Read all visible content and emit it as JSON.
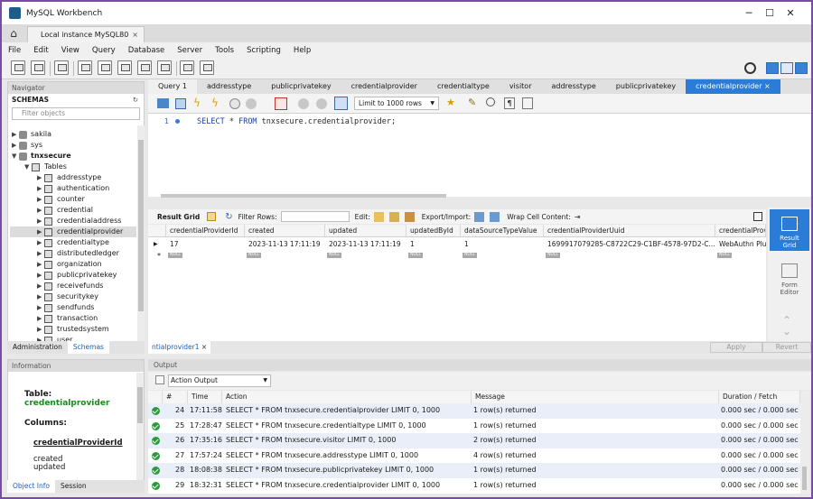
{
  "window": {
    "title": "MySQL Workbench",
    "minimize": "─",
    "maximize": "☐",
    "close": "✕"
  },
  "conn_tab": {
    "label": "Local instance MySQL80",
    "close": "×"
  },
  "menu": [
    "File",
    "Edit",
    "View",
    "Query",
    "Database",
    "Server",
    "Tools",
    "Scripting",
    "Help"
  ],
  "navigator": {
    "header": "Navigator",
    "schemas_label": "SCHEMAS",
    "filter_placeholder": "Filter objects",
    "schemas": [
      "sakila",
      "sys",
      "tnxsecure"
    ],
    "tables_label": "Tables",
    "tables": [
      "addresstype",
      "authentication",
      "counter",
      "credential",
      "credentialaddress",
      "credentialprovider",
      "credentialtype",
      "distributedledger",
      "organization",
      "publicprivatekey",
      "receivefunds",
      "securitykey",
      "sendfunds",
      "transaction",
      "trustedsystem",
      "user"
    ]
  },
  "left_tabs": [
    "Administration",
    "Schemas"
  ],
  "information": {
    "header": "Information",
    "table_label": "Table:",
    "table_name": "credentialprovider",
    "columns_label": "Columns:",
    "columns": [
      "credentialProviderId",
      "created",
      "updated"
    ]
  },
  "info_tabs": [
    "Object Info",
    "Session"
  ],
  "query_tabs": [
    "Query 1",
    "addresstype",
    "publicprivatekey",
    "credentialprovider",
    "credentialtype",
    "visitor",
    "addresstype",
    "publicprivatekey",
    "credentialprovider"
  ],
  "active_tab_close": "×",
  "limit_label": "Limit to 1000 rows",
  "editor": {
    "line_no": "1",
    "sql_kw1": "SELECT",
    "sql_mid": " * ",
    "sql_kw2": "FROM",
    "sql_rest": " tnxsecure.credentialprovider;"
  },
  "result_toolbar": {
    "result_grid": "Result Grid",
    "filter_rows": "Filter Rows:",
    "edit": "Edit:",
    "export_import": "Export/Import:",
    "wrap": "Wrap Cell Content:"
  },
  "grid": {
    "columns": [
      "credentialProviderId",
      "created",
      "updated",
      "updatedById",
      "dataSourceTypeValue",
      "credentialProviderUuid",
      "credentialProvi"
    ],
    "row": [
      "17",
      "2023-11-13 17:11:19",
      "2023-11-13 17:11:19",
      "1",
      "1",
      "1699917079285-C8722C29-C1BF-4578-97D2-C...",
      "WebAuthn Plus"
    ],
    "null_text": "NULL"
  },
  "right_buttons": [
    {
      "label1": "Result",
      "label2": "Grid"
    },
    {
      "label1": "Form",
      "label2": "Editor"
    }
  ],
  "editor_bottom": {
    "tab": "ntialprovider1",
    "close": "×",
    "apply": "Apply",
    "revert": "Revert"
  },
  "output": {
    "header": "Output",
    "selector": "Action Output",
    "columns": [
      "#",
      "Time",
      "Action",
      "Message",
      "Duration / Fetch"
    ],
    "rows": [
      {
        "n": "24",
        "time": "17:11:58",
        "action": "SELECT * FROM tnxsecure.credentialprovider LIMIT 0, 1000",
        "message": "1 row(s) returned",
        "duration": "0.000 sec / 0.000 sec"
      },
      {
        "n": "25",
        "time": "17:28:47",
        "action": "SELECT * FROM tnxsecure.credentialtype LIMIT 0, 1000",
        "message": "1 row(s) returned",
        "duration": "0.000 sec / 0.000 sec"
      },
      {
        "n": "26",
        "time": "17:35:16",
        "action": "SELECT * FROM tnxsecure.visitor LIMIT 0, 1000",
        "message": "2 row(s) returned",
        "duration": "0.000 sec / 0.000 sec"
      },
      {
        "n": "27",
        "time": "17:57:24",
        "action": "SELECT * FROM tnxsecure.addresstype LIMIT 0, 1000",
        "message": "4 row(s) returned",
        "duration": "0.000 sec / 0.000 sec"
      },
      {
        "n": "28",
        "time": "18:08:38",
        "action": "SELECT * FROM tnxsecure.publicprivatekey LIMIT 0, 1000",
        "message": "1 row(s) returned",
        "duration": "0.000 sec / 0.000 sec"
      },
      {
        "n": "29",
        "time": "18:32:31",
        "action": "SELECT * FROM tnxsecure.credentialprovider LIMIT 0, 1000",
        "message": "1 row(s) returned",
        "duration": "0.000 sec / 0.000 sec"
      }
    ]
  }
}
